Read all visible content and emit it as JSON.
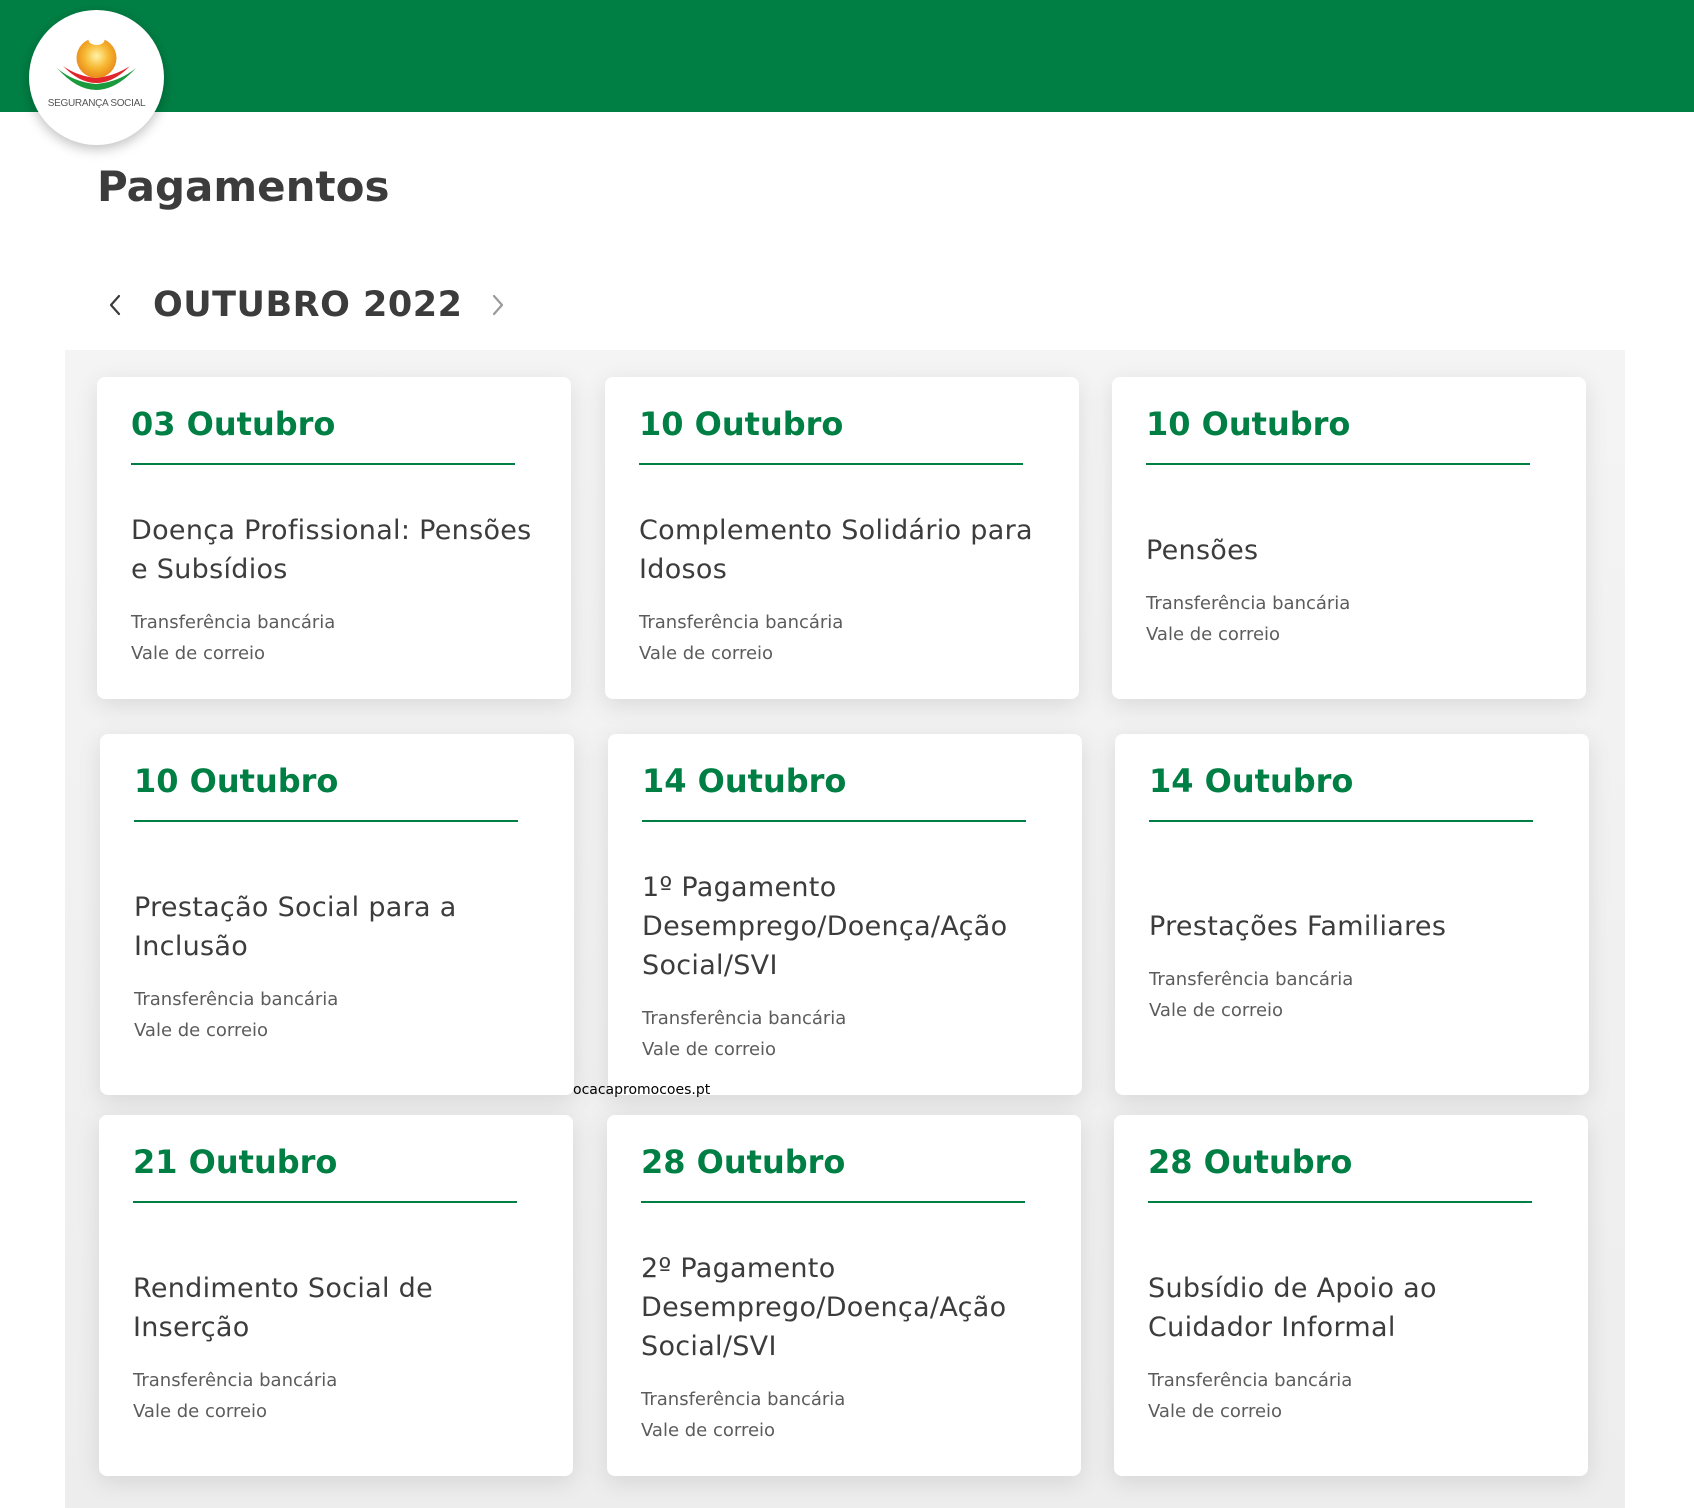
{
  "header": {
    "brand_color": "#007f44",
    "logo_text": "SEGURANÇA SOCIAL"
  },
  "page": {
    "title": "Pagamentos"
  },
  "month_nav": {
    "prev_icon": "chevron-left-icon",
    "next_icon": "chevron-right-icon",
    "label": "OUTUBRO 2022"
  },
  "cards": [
    {
      "date": "03 Outubro",
      "title": "Doença Profissional: Pensões e Subsídios",
      "methods": [
        "Transferência bancária",
        "Vale de correio"
      ]
    },
    {
      "date": "10 Outubro",
      "title": "Complemento Solidário para Idosos",
      "methods": [
        "Transferência bancária",
        "Vale de correio"
      ]
    },
    {
      "date": "10 Outubro",
      "title": "Pensões",
      "methods": [
        "Transferência bancária",
        "Vale de correio"
      ]
    },
    {
      "date": "10 Outubro",
      "title": "Prestação Social para a Inclusão",
      "methods": [
        "Transferência bancária",
        "Vale de correio"
      ]
    },
    {
      "date": "14 Outubro",
      "title": "1º Pagamento Desemprego/Doença/Ação Social/SVI",
      "methods": [
        "Transferência bancária",
        "Vale de correio"
      ]
    },
    {
      "date": "14 Outubro",
      "title": "Prestações Familiares",
      "methods": [
        "Transferência bancária",
        "Vale de correio"
      ]
    },
    {
      "date": "21 Outubro",
      "title": "Rendimento Social de Inserção",
      "methods": [
        "Transferência bancária",
        "Vale de correio"
      ]
    },
    {
      "date": "28 Outubro",
      "title": "2º Pagamento Desemprego/Doença/Ação Social/SVI",
      "methods": [
        "Transferência bancária",
        "Vale de correio"
      ]
    },
    {
      "date": "28 Outubro",
      "title": "Subsídio de Apoio ao Cuidador Informal",
      "methods": [
        "Transferência bancária",
        "Vale de correio"
      ]
    }
  ],
  "watermark": "ocacapromocoes.pt"
}
